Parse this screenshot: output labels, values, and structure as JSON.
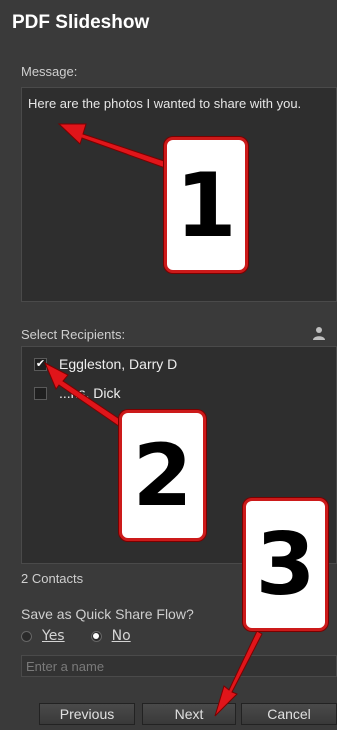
{
  "dialog": {
    "title": "PDF Slideshow",
    "message_label": "Message:",
    "message_text": "Here are the photos I wanted to share with you.",
    "recipients_label": "Select Recipients:",
    "recipients": [
      {
        "name": "Eggleston, Darry D",
        "checked": true
      },
      {
        "name": "...ns, Dick",
        "checked": false
      }
    ],
    "contacts_count": "2 Contacts",
    "quick_share_label": "Save as Quick Share Flow?",
    "radio_yes": "Yes",
    "radio_no": "No",
    "radio_selected": "No",
    "name_placeholder": "Enter a name",
    "buttons": {
      "previous": "Previous",
      "next": "Next",
      "cancel": "Cancel"
    }
  },
  "annotations": {
    "callout_1": "1",
    "callout_2": "2",
    "callout_3": "3",
    "arrow_color": "#e0151a"
  }
}
